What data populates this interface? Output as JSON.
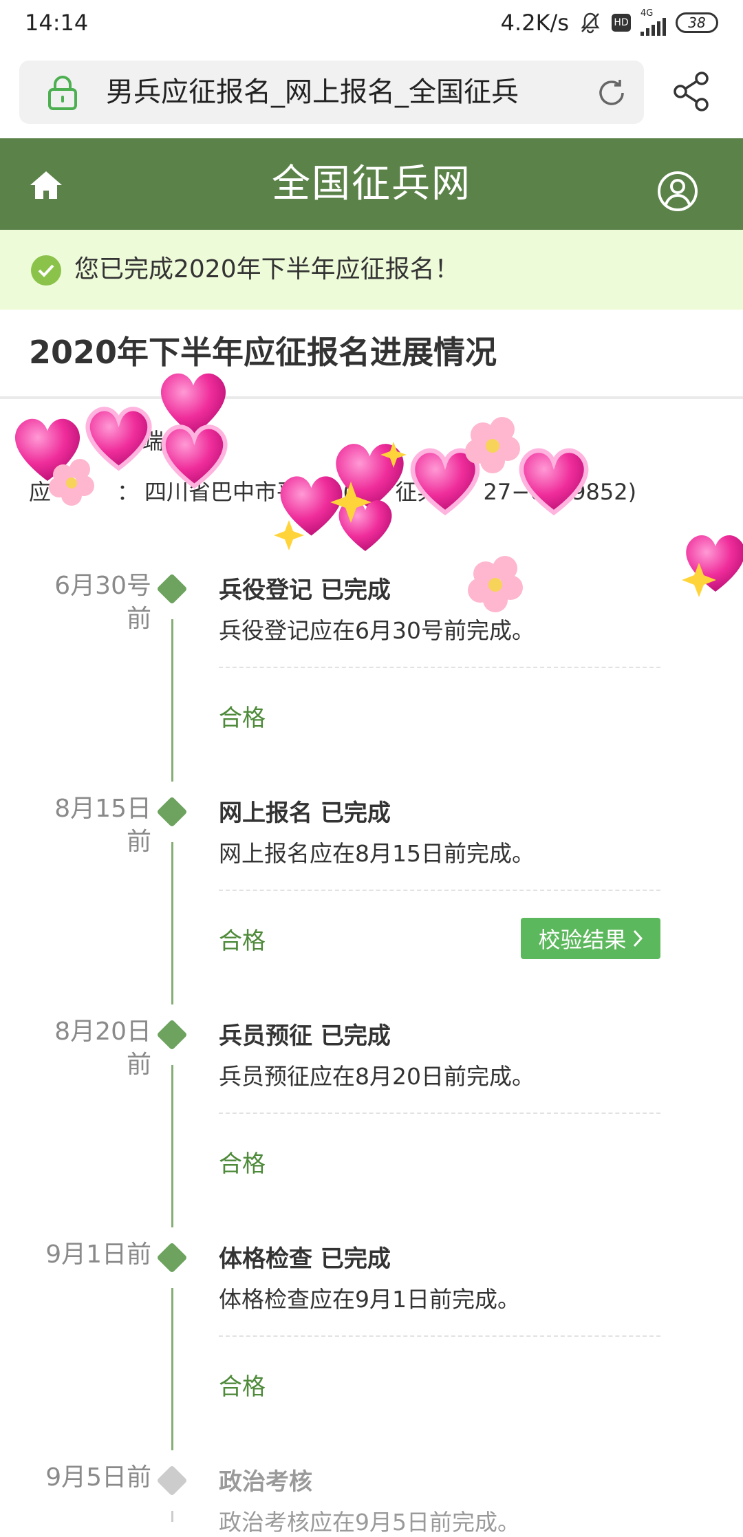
{
  "status_bar": {
    "time": "14:14",
    "speed": "4.2K/s",
    "hd": "HD",
    "network": "4G",
    "battery": "38"
  },
  "browser": {
    "url_title": "男兵应征报名_网上报名_全国征兵"
  },
  "header": {
    "title": "全国征兵网"
  },
  "notice": {
    "text": "您已完成2020年下半年应征报名！"
  },
  "section": {
    "title": "2020年下半年应征报名进展情况"
  },
  "info": {
    "line1": "端",
    "line2": "四川省巴中市平　　(平　征兵办　27−6229852)",
    "line2_prefix": "应",
    "line2_sep": "："
  },
  "steps": [
    {
      "date_line1": "6月30号",
      "date_line2": "前",
      "title": "兵役登记 已完成",
      "desc": "兵役登记应在6月30号前完成。",
      "result": "合格"
    },
    {
      "date_line1": "8月15日",
      "date_line2": "前",
      "title": "网上报名 已完成",
      "desc": "网上报名应在8月15日前完成。",
      "result": "合格",
      "button": "校验结果"
    },
    {
      "date_line1": "8月20日",
      "date_line2": "前",
      "title": "兵员预征 已完成",
      "desc": "兵员预征应在8月20日前完成。",
      "result": "合格"
    },
    {
      "date_line1": "9月1日前",
      "date_line2": "",
      "title": "体格检查 已完成",
      "desc": "体格检查应在9月1日前完成。",
      "result": "合格"
    },
    {
      "date_line1": "9月5日前",
      "date_line2": "",
      "title": "政治考核",
      "desc": "政治考核应在9月5日前完成。"
    }
  ],
  "colors": {
    "header_green": "#5b8249",
    "notice_bg": "#eefbd9",
    "dot_green": "#6da35e",
    "result_green": "#4e8a3a",
    "button_green": "#5cb85c"
  }
}
